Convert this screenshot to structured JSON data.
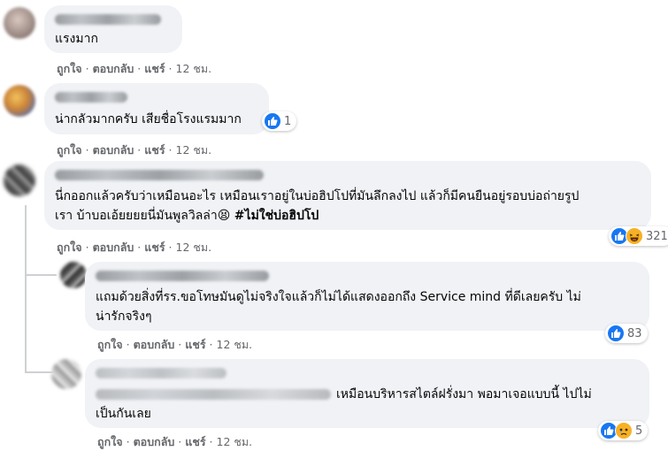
{
  "comments": [
    {
      "text": "แรงมาก",
      "actions": {
        "like": "ถูกใจ",
        "reply": "ตอบกลับ",
        "share": "แชร์",
        "time": "12 ชม."
      }
    },
    {
      "text": "น่ากลัวมากครับ เสียชื่อโรงแรมมาก",
      "reaction_count": "1",
      "reaction_icons": [
        "like-icon"
      ],
      "actions": {
        "like": "ถูกใจ",
        "reply": "ตอบกลับ",
        "share": "แชร์",
        "time": "12 ชม."
      }
    },
    {
      "text_line1": "นี่กออกแล้วครับว่าเหมือนอะไร เหมือนเราอยู่ในบ่อฮิปโปที่มันลึกลงไป แล้วก็มีคนยืนอยู่รอบบ่อถ่ายรูป",
      "text_line2": "เรา บ้าบอเอ้ยยยยนี่มันพูลวิลล่า",
      "emoji": "😫",
      "hashtag": "#ไม่ใช่บ่อฮิปโป",
      "reaction_count": "321",
      "reaction_icons": [
        "like-icon",
        "haha-icon"
      ],
      "actions": {
        "like": "ถูกใจ",
        "reply": "ตอบกลับ",
        "share": "แชร์",
        "time": "12 ชม."
      }
    },
    {
      "text_line1": "แถมด้วยสิ่งที่รร.ขอโทษมันดูไม่จริงใจแล้วก็ไม่ได้แสดงออกถึง Service mind ที่ดีเลยครับ ไม่",
      "text_line2": "น่ารักจริงๆ",
      "reaction_count": "83",
      "reaction_icons": [
        "like-icon"
      ],
      "actions": {
        "like": "ถูกใจ",
        "reply": "ตอบกลับ",
        "share": "แชร์",
        "time": "12 ชม."
      }
    },
    {
      "text_line1": "เหมือนบริหารสไตล์ฝรั่งมา พอมาเจอแบบนี้ ไปไม่",
      "text_line2": "เป็นกันเลย",
      "reaction_count": "5",
      "reaction_icons": [
        "like-icon",
        "sad-icon"
      ],
      "actions": {
        "like": "ถูกใจ",
        "reply": "ตอบกลับ",
        "share": "แชร์",
        "time": "12 ชม."
      }
    }
  ],
  "colors": {
    "bubble": "#f0f2f5",
    "meta_text": "#65676b",
    "like_blue": "#1877f2",
    "emoji_yellow": "#f7b125"
  }
}
